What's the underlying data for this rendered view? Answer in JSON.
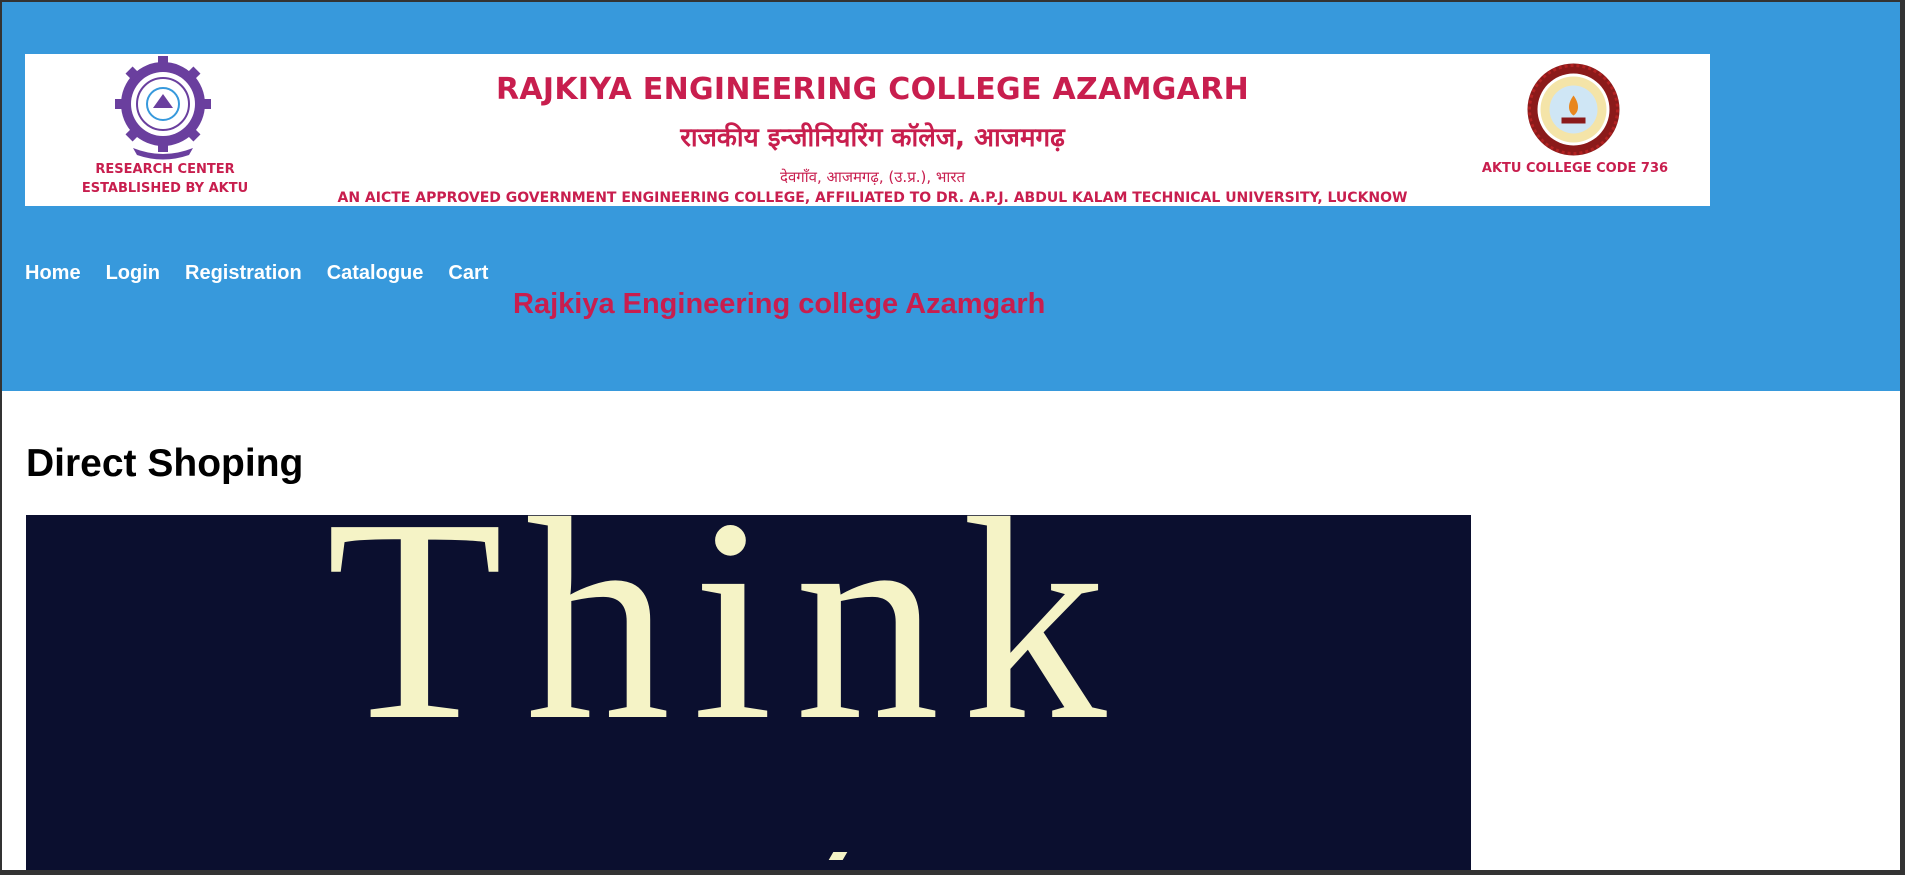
{
  "header": {
    "title_en": "RAJKIYA ENGINEERING COLLEGE AZAMGARH",
    "title_hi": "राजकीय इन्जीनियरिंग कॉलेज, आजमगढ़",
    "subtitle_hi": "देवगाँव, आजमगढ़, (उ.प्र.), भारत",
    "affiliation": "AN AICTE APPROVED GOVERNMENT ENGINEERING COLLEGE, AFFILIATED TO DR. A.P.J. ABDUL KALAM TECHNICAL UNIVERSITY, LUCKNOW",
    "left_caption_line1": "RESEARCH CENTER",
    "left_caption_line2": "ESTABLISHED BY AKTU",
    "right_caption": "AKTU COLLEGE CODE 736"
  },
  "nav": {
    "items": [
      "Home",
      "Login",
      "Registration",
      "Catalogue",
      "Cart"
    ]
  },
  "marquee_text": "Rajkiya Engineering college Azamgarh",
  "main": {
    "heading": "Direct Shoping",
    "book_cover_text": "Think"
  },
  "colors": {
    "header_blue": "#3799dc",
    "brand_red": "#c81e4e",
    "book_bg": "#0b0f2f",
    "book_text": "#f5f3c6",
    "left_logo": "#6a3f9e",
    "right_logo": "#8b1a1a"
  },
  "icons": {
    "left_logo": "research-center-logo-icon",
    "right_logo": "aktu-seal-icon"
  }
}
